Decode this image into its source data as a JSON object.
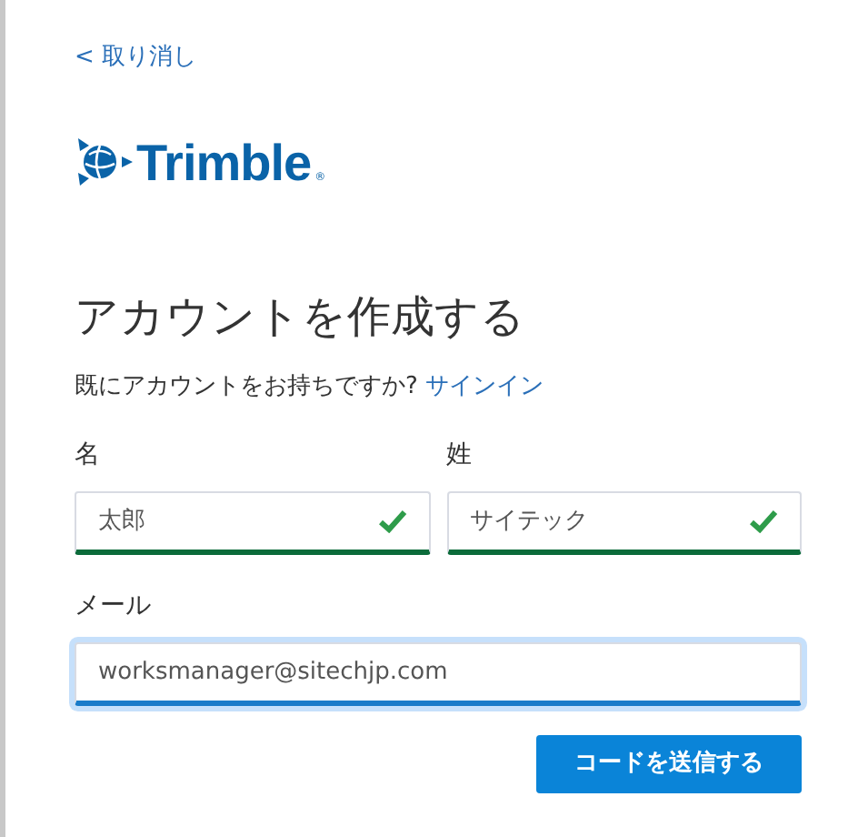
{
  "cancel_link": {
    "arrow": "<",
    "label": "取り消し"
  },
  "logo": {
    "text": "Trimble",
    "mark": "®"
  },
  "title": "アカウントを作成する",
  "signin_prompt": {
    "text": "既にアカウントをお持ちですか?",
    "link": "サインイン"
  },
  "name_fields": [
    {
      "label": "名",
      "value": "太郎",
      "valid": true,
      "focused": false
    },
    {
      "label": "姓",
      "value": "サイテック",
      "valid": true,
      "focused": false
    }
  ],
  "email_field": {
    "label": "メール",
    "value": "worksmanager@sitechjp.com",
    "valid": false,
    "focused": true
  },
  "submit_button": "コードを送信する"
}
